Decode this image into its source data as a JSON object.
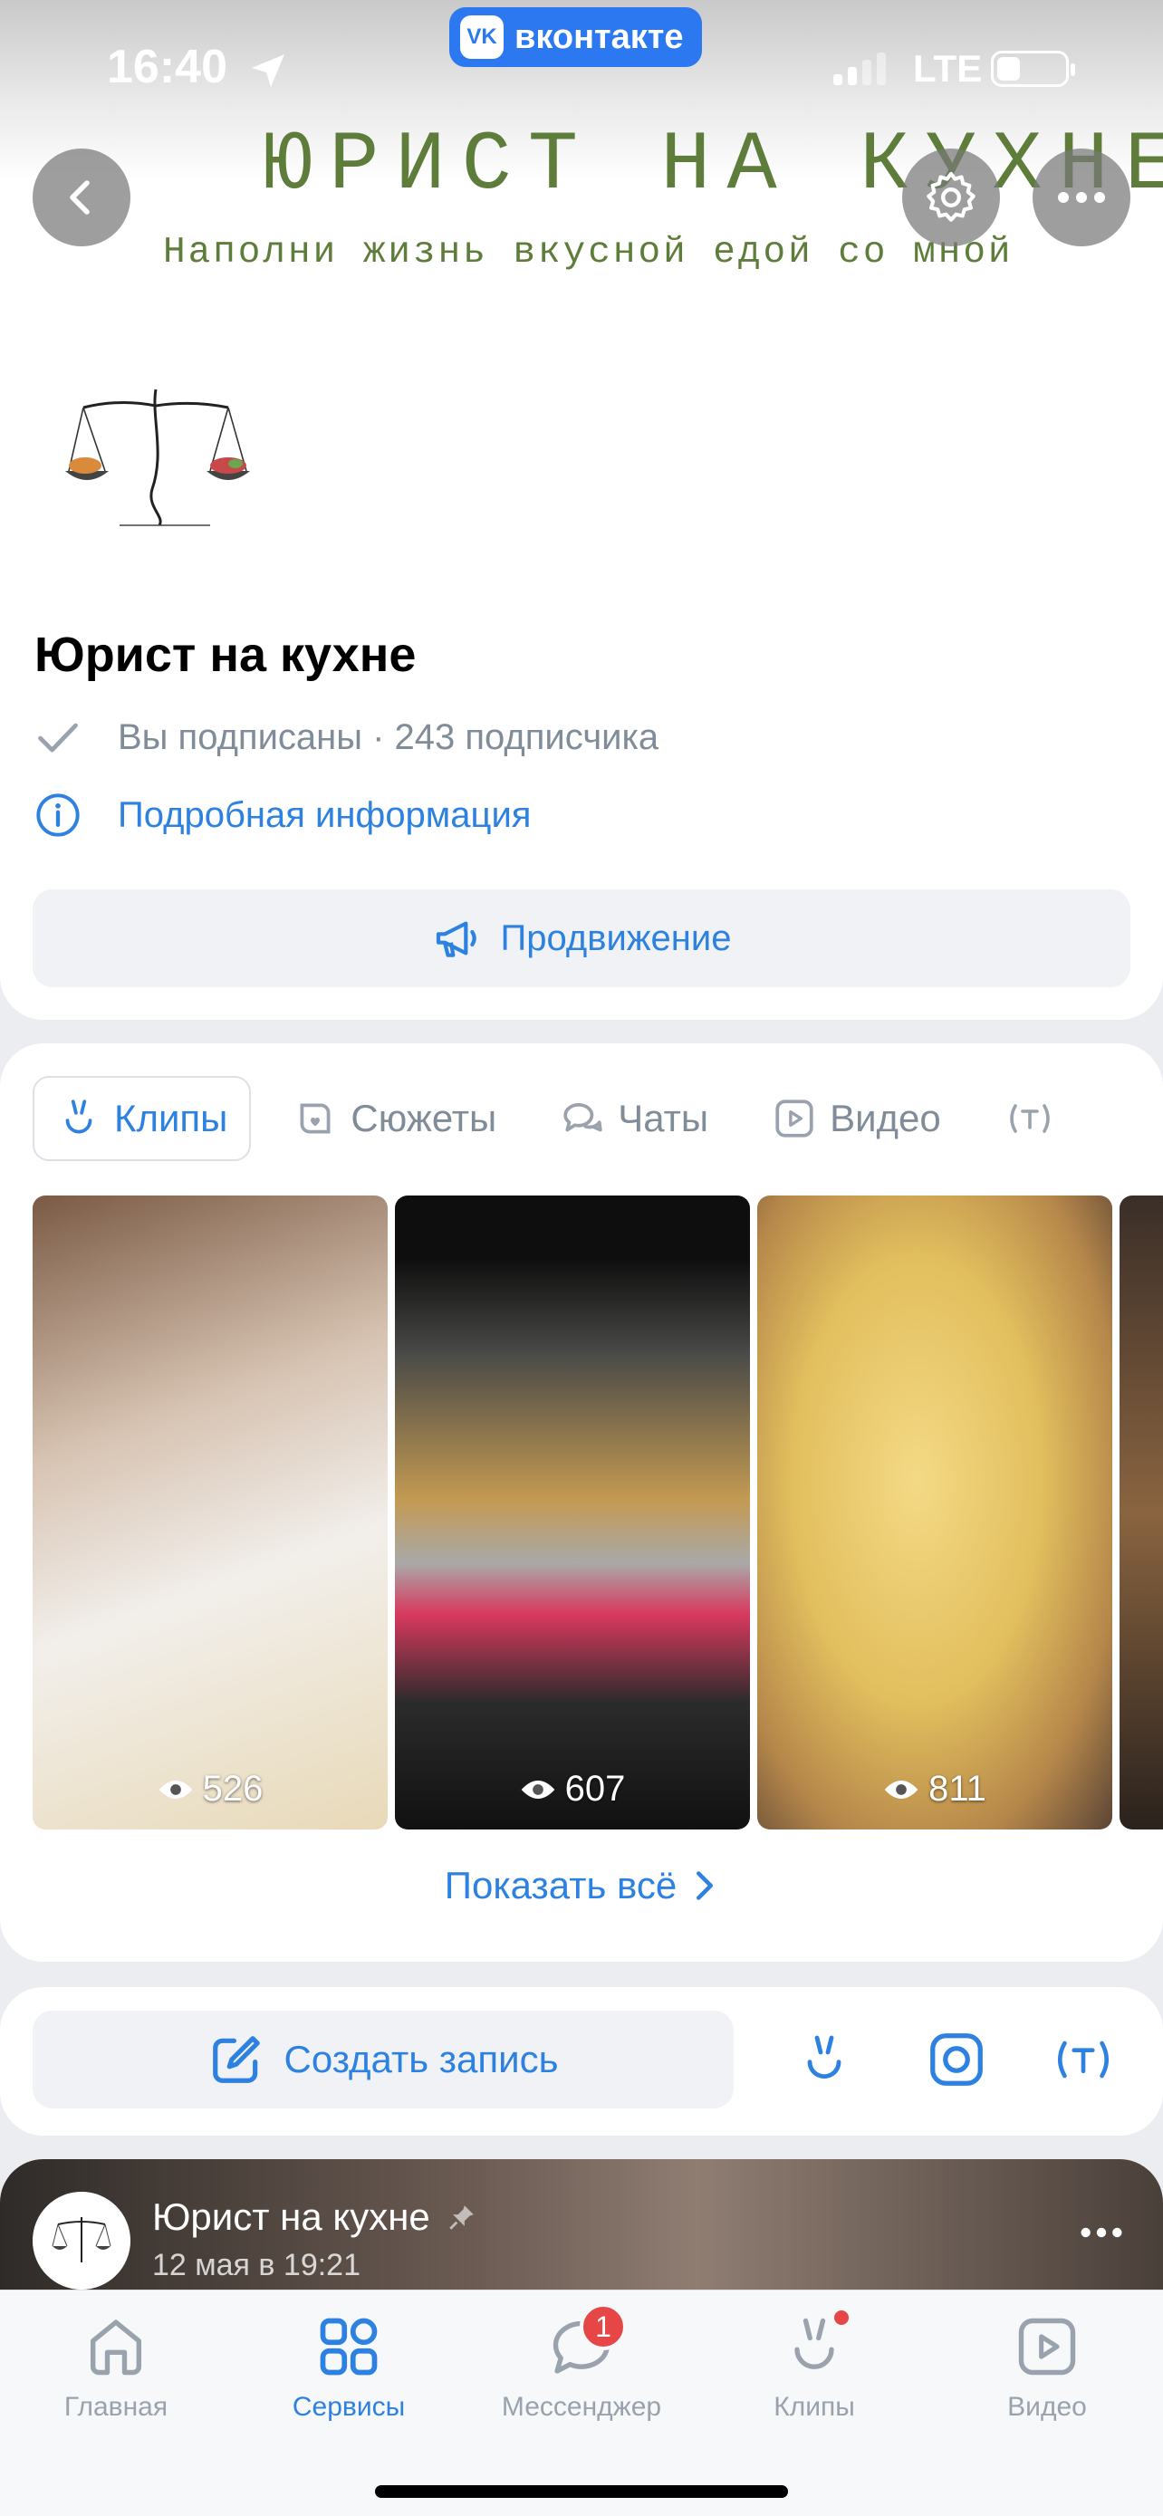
{
  "status_bar": {
    "time": "16:40",
    "app_badge_label": "вконтакте",
    "app_badge_logo": "VK",
    "network": "LTE",
    "battery_fraction": 0.35
  },
  "cover": {
    "title": "ЮРИСТ НА КУХНЕ",
    "subtitle": "Наполни жизнь вкусной едой со мной"
  },
  "profile": {
    "name": "Юрист на кухне",
    "subscription_status": "Вы подписаны · 243 подписчика",
    "details_link": "Подробная информация",
    "promo_button": "Продвижение"
  },
  "tabs": [
    {
      "label": "Клипы",
      "icon": "clips-icon",
      "active": true
    },
    {
      "label": "Сюжеты",
      "icon": "stories-icon",
      "active": false
    },
    {
      "label": "Чаты",
      "icon": "chats-icon",
      "active": false
    },
    {
      "label": "Видео",
      "icon": "video-icon",
      "active": false
    }
  ],
  "clips": [
    {
      "views": "526"
    },
    {
      "views": "607"
    },
    {
      "views": "811"
    }
  ],
  "show_all": "Показать всё",
  "create_post": {
    "label": "Создать запись"
  },
  "post": {
    "author": "Юрист на кухне",
    "date": "12 мая в 19:21"
  },
  "bottom_nav": [
    {
      "label": "Главная",
      "icon": "home-icon",
      "active": false
    },
    {
      "label": "Сервисы",
      "icon": "services-icon",
      "active": true
    },
    {
      "label": "Мессенджер",
      "icon": "messenger-icon",
      "active": false,
      "badge": "1"
    },
    {
      "label": "Клипы",
      "icon": "clips-nav-icon",
      "active": false
    },
    {
      "label": "Видео",
      "icon": "video-nav-icon",
      "active": false
    }
  ],
  "colors": {
    "accent": "#2d81e0",
    "secondary_text": "#818c99",
    "brand_green": "#5f7d3a",
    "badge_red": "#e64646"
  }
}
